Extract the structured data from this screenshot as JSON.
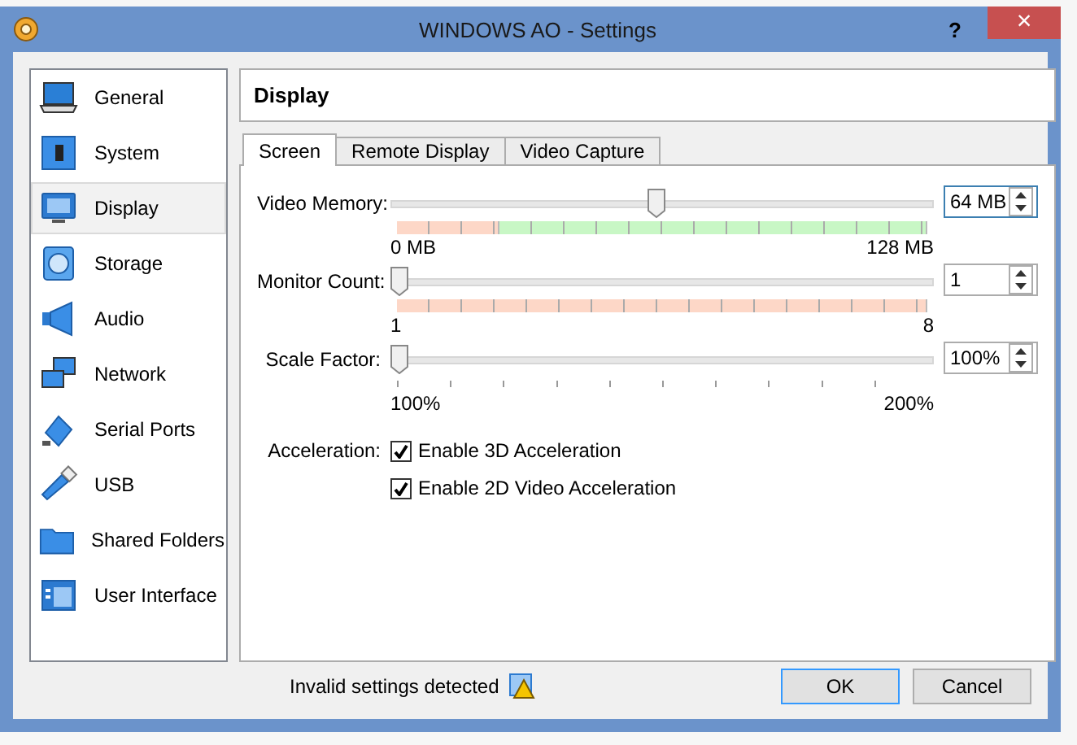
{
  "window": {
    "title": "WINDOWS AO - Settings",
    "help": "?",
    "close": "×"
  },
  "sidebar": {
    "items": [
      {
        "label": "General",
        "selected": false
      },
      {
        "label": "System",
        "selected": false
      },
      {
        "label": "Display",
        "selected": true
      },
      {
        "label": "Storage",
        "selected": false
      },
      {
        "label": "Audio",
        "selected": false
      },
      {
        "label": "Network",
        "selected": false
      },
      {
        "label": "Serial Ports",
        "selected": false
      },
      {
        "label": "USB",
        "selected": false
      },
      {
        "label": "Shared Folders",
        "selected": false
      },
      {
        "label": "User Interface",
        "selected": false
      }
    ]
  },
  "header": "Display",
  "tabs": [
    {
      "label": "Screen",
      "selected": true
    },
    {
      "label": "Remote Display",
      "selected": false
    },
    {
      "label": "Video Capture",
      "selected": false
    }
  ],
  "sliders": [
    {
      "kind": "memory",
      "label": "Video Memory:",
      "level": 0.49,
      "min": "0 MB",
      "max": "128 MB",
      "value": "64 MB",
      "focused": true
    },
    {
      "kind": "count",
      "label": "Monitor Count:",
      "level": 0,
      "min": "1",
      "max": "8",
      "value": "1",
      "focused": false
    },
    {
      "kind": "plain",
      "label": "Scale Factor:",
      "level": 0,
      "min": "100%",
      "max": "200%",
      "value": "100%",
      "focused": false
    }
  ],
  "acceleration": {
    "label": "Acceleration:",
    "options": [
      {
        "label": "Enable 3D Acceleration",
        "checked": true
      },
      {
        "label": "Enable 2D Video Acceleration",
        "checked": true
      }
    ]
  },
  "status": {
    "text": "Invalid settings detected"
  },
  "buttons": [
    {
      "label": "OK",
      "selected": true
    },
    {
      "label": "Cancel",
      "selected": false
    }
  ]
}
